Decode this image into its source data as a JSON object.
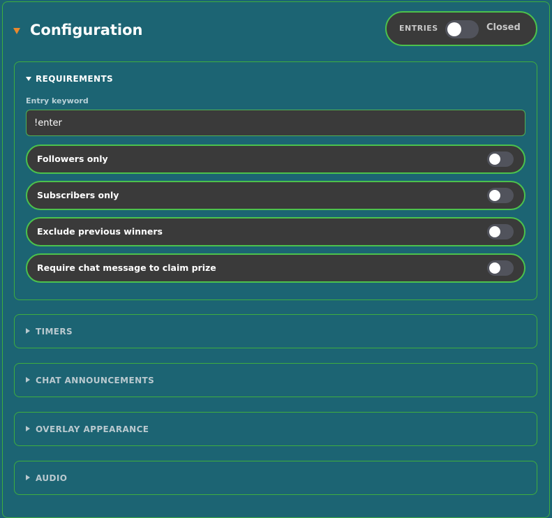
{
  "header": {
    "title": "Configuration",
    "entries_label": "ENTRIES",
    "entries_status": "Closed",
    "entries_open": false,
    "accent_color": "#e8892e"
  },
  "requirements": {
    "title": "REQUIREMENTS",
    "expanded": true,
    "keyword_label": "Entry keyword",
    "keyword_value": "!enter",
    "options": [
      {
        "label": "Followers only",
        "enabled": false
      },
      {
        "label": "Subscribers only",
        "enabled": false
      },
      {
        "label": "Exclude previous winners",
        "enabled": false
      },
      {
        "label": "Require chat message to claim prize",
        "enabled": false
      }
    ]
  },
  "sections": [
    {
      "title": "TIMERS",
      "expanded": false
    },
    {
      "title": "CHAT ANNOUNCEMENTS",
      "expanded": false
    },
    {
      "title": "OVERLAY APPEARANCE",
      "expanded": false
    },
    {
      "title": "AUDIO",
      "expanded": false
    }
  ],
  "colors": {
    "background": "#1c6473",
    "border": "#3fae3f",
    "pill": "#3a3a3a"
  }
}
